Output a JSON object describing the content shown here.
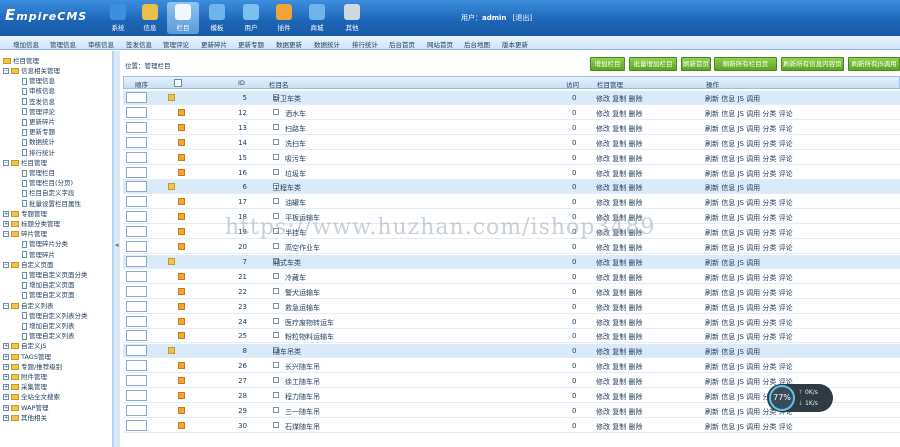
{
  "brand": {
    "logo_big": "E",
    "logo_rest": "mpireCMS"
  },
  "topnav": [
    {
      "label": "系统",
      "color": "#3c8fe0",
      "icon": "system-icon"
    },
    {
      "label": "信息",
      "color": "#e9c14a",
      "icon": "pencil-icon"
    },
    {
      "label": "栏目",
      "color": "#f0f7ff",
      "icon": "folder-icon"
    },
    {
      "label": "模板",
      "color": "#6fb4ea",
      "icon": "template-icon"
    },
    {
      "label": "用户",
      "color": "#7bc0f0",
      "icon": "user-icon"
    },
    {
      "label": "插件",
      "color": "#f0a437",
      "icon": "plugin-icon"
    },
    {
      "label": "商城",
      "color": "#6fb4ea",
      "icon": "shop-icon"
    },
    {
      "label": "其他",
      "color": "#cfd8e2",
      "icon": "gear-icon"
    }
  ],
  "user": {
    "prefix": "用户：",
    "name": "admin",
    "logout": "[退出]"
  },
  "subnav": [
    "增加信息",
    "管理信息",
    "审核信息",
    "签发信息",
    "管理评论",
    "更新碎片",
    "更新专题",
    "数据更新",
    "数据统计",
    "排行统计",
    "后台首页",
    "网站首页",
    "后台地图",
    "版本更新"
  ],
  "sidebar": {
    "root": "栏目管理",
    "items": [
      {
        "type": "group",
        "label": "信息相关管理"
      },
      {
        "type": "leaf",
        "label": "管理信息"
      },
      {
        "type": "leaf",
        "label": "审核信息"
      },
      {
        "type": "leaf",
        "label": "签发信息"
      },
      {
        "type": "leaf",
        "label": "管理评论"
      },
      {
        "type": "leaf",
        "label": "更新碎片"
      },
      {
        "type": "leaf",
        "label": "更新专题"
      },
      {
        "type": "leaf",
        "label": "数据统计"
      },
      {
        "type": "leaf",
        "label": "排行统计"
      },
      {
        "type": "group",
        "label": "栏目管理"
      },
      {
        "type": "leaf",
        "label": "管理栏目"
      },
      {
        "type": "leaf",
        "label": "管理栏目(分页)"
      },
      {
        "type": "leaf",
        "label": "栏目自定义字段"
      },
      {
        "type": "leaf",
        "label": "批量设置栏目属性"
      },
      {
        "type": "closed",
        "label": "专题管理"
      },
      {
        "type": "closed",
        "label": "标题分类管理"
      },
      {
        "type": "group",
        "label": "碎片管理"
      },
      {
        "type": "leaf",
        "label": "管理碎片分类"
      },
      {
        "type": "leaf",
        "label": "管理碎片"
      },
      {
        "type": "group",
        "label": "自定义页面"
      },
      {
        "type": "leaf",
        "label": "管理自定义页面分类"
      },
      {
        "type": "leaf",
        "label": "增加自定义页面"
      },
      {
        "type": "leaf",
        "label": "管理自定义页面"
      },
      {
        "type": "group",
        "label": "自定义列表"
      },
      {
        "type": "leaf",
        "label": "管理自定义列表分类"
      },
      {
        "type": "leaf",
        "label": "增加自定义列表"
      },
      {
        "type": "leaf",
        "label": "管理自定义列表"
      },
      {
        "type": "closed",
        "label": "自定义JS"
      },
      {
        "type": "closed",
        "label": "TAGS管理"
      },
      {
        "type": "closed",
        "label": "专题/推荐级别"
      },
      {
        "type": "closed",
        "label": "附件管理"
      },
      {
        "type": "closed",
        "label": "采集管理"
      },
      {
        "type": "closed",
        "label": "全站全文搜索"
      },
      {
        "type": "closed",
        "label": "WAP管理"
      },
      {
        "type": "closed",
        "label": "其他相关"
      }
    ]
  },
  "main": {
    "crumb": "位置：管理栏目",
    "buttons": [
      "增加栏目",
      "批量增加栏目",
      "刷新首页",
      "刷新所有栏目页",
      "刷新所有信息内容页",
      "刷新所有JS调用"
    ],
    "headers": {
      "order": "顺序",
      "id": "ID",
      "name": "栏目名",
      "visits": "访问",
      "manage": "栏目管理",
      "ops": "操作"
    },
    "cat_manage": "修改 复制 删除",
    "cat_ops": "刷新 信息 JS 调用",
    "leaf_ops": "刷新 信息 JS 调用 分类 评论",
    "rows": [
      {
        "type": "cat",
        "id": "5",
        "name": "新卫车类",
        "visits": "0"
      },
      {
        "type": "leaf",
        "id": "12",
        "name": "洒水车",
        "visits": "0"
      },
      {
        "type": "leaf",
        "id": "13",
        "name": "扫路车",
        "visits": "0"
      },
      {
        "type": "leaf",
        "id": "14",
        "name": "洗扫车",
        "visits": "0"
      },
      {
        "type": "leaf",
        "id": "15",
        "name": "吸污车",
        "visits": "0"
      },
      {
        "type": "leaf",
        "id": "16",
        "name": "垃圾车",
        "visits": "0"
      },
      {
        "type": "cat",
        "id": "6",
        "name": "工程车类",
        "visits": "0"
      },
      {
        "type": "leaf",
        "id": "17",
        "name": "油罐车",
        "visits": "0"
      },
      {
        "type": "leaf",
        "id": "18",
        "name": "平板运输车",
        "visits": "0"
      },
      {
        "type": "leaf",
        "id": "19",
        "name": "半挂车",
        "visits": "0"
      },
      {
        "type": "leaf",
        "id": "20",
        "name": "高空作业车",
        "visits": "0"
      },
      {
        "type": "cat",
        "id": "7",
        "name": "厢式车类",
        "visits": "0"
      },
      {
        "type": "leaf",
        "id": "21",
        "name": "冷藏车",
        "visits": "0"
      },
      {
        "type": "leaf",
        "id": "22",
        "name": "警犬运输车",
        "visits": "0"
      },
      {
        "type": "leaf",
        "id": "23",
        "name": "救急运输车",
        "visits": "0"
      },
      {
        "type": "leaf",
        "id": "24",
        "name": "医疗废物转运车",
        "visits": "0"
      },
      {
        "type": "leaf",
        "id": "25",
        "name": "粉粒物料运输车",
        "visits": "0"
      },
      {
        "type": "cat",
        "id": "8",
        "name": "随车吊类",
        "visits": "0"
      },
      {
        "type": "leaf",
        "id": "26",
        "name": "长兴随车吊",
        "visits": "0"
      },
      {
        "type": "leaf",
        "id": "27",
        "name": "徐工随车吊",
        "visits": "0"
      },
      {
        "type": "leaf",
        "id": "28",
        "name": "程力随车吊",
        "visits": "0"
      },
      {
        "type": "leaf",
        "id": "29",
        "name": "三一随车吊",
        "visits": "0"
      },
      {
        "type": "leaf",
        "id": "30",
        "name": "石煤随车吊",
        "visits": "0"
      }
    ]
  },
  "watermark": "https://www.huzhan.com/ishop3489",
  "gauge": {
    "value": "77%",
    "up": "0K/s",
    "down": "1K/s",
    "up_arrow": "↑",
    "down_arrow": "↓"
  },
  "splitter_arrow": "◂"
}
